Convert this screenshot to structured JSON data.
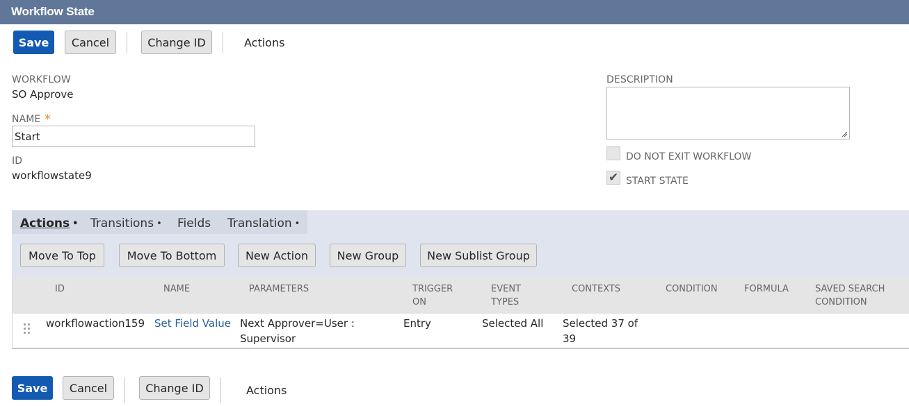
{
  "window": {
    "title": "Workflow State"
  },
  "toolbar": {
    "save_label": "Save",
    "cancel_label": "Cancel",
    "change_id_label": "Change ID",
    "actions_label": "Actions"
  },
  "form": {
    "workflow_label": "WORKFLOW",
    "workflow_value": "SO Approve",
    "name_label": "NAME",
    "name_required_marker": "*",
    "name_value": "Start",
    "id_label": "ID",
    "id_value": "workflowstate9",
    "description_label": "DESCRIPTION",
    "description_value": "",
    "do_not_exit_label": "DO NOT EXIT WORKFLOW",
    "do_not_exit_checked": false,
    "start_state_label": "START STATE",
    "start_state_checked": true
  },
  "tabs": [
    {
      "label": "Actions",
      "has_dot": true,
      "active": true
    },
    {
      "label": "Transitions",
      "has_dot": true,
      "active": false
    },
    {
      "label": "Fields",
      "has_dot": false,
      "active": false
    },
    {
      "label": "Translation",
      "has_dot": true,
      "active": false
    }
  ],
  "tab_dot": "•",
  "sublist_buttons": {
    "move_to_top": "Move To Top",
    "move_to_bottom": "Move To Bottom",
    "new_action": "New Action",
    "new_group": "New Group",
    "new_sublist_group": "New Sublist Group"
  },
  "grid": {
    "columns": {
      "id": "ID",
      "name": "NAME",
      "parameters": "PARAMETERS",
      "trigger_on": [
        "TRIGGER",
        "ON"
      ],
      "event_types": [
        "EVENT",
        "TYPES"
      ],
      "contexts": "CONTEXTS",
      "condition": "CONDITION",
      "formula": "FORMULA",
      "saved_search_condition": [
        "SAVED SEARCH",
        "CONDITION"
      ]
    },
    "rows": [
      {
        "id": "workflowaction159",
        "name": "Set Field Value",
        "parameters": [
          "Next Approver=User :",
          "Supervisor"
        ],
        "trigger_on": "Entry",
        "event_types": "Selected All",
        "contexts": [
          "Selected 37 of",
          "39"
        ],
        "condition": "",
        "formula": "",
        "saved_search_condition": ""
      }
    ]
  },
  "colors": {
    "title_bar": "#607799",
    "primary_button": "#125ab2",
    "link": "#255f9e",
    "required_marker": "#e48a1b",
    "tab_panel": "#dfe4ee"
  }
}
